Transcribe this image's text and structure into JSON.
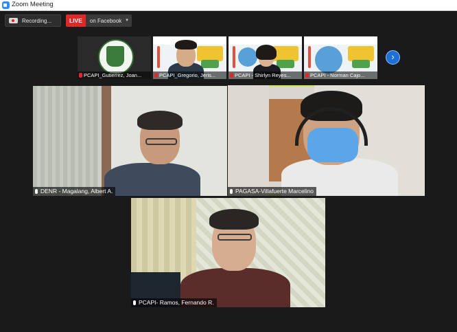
{
  "window": {
    "title": "Zoom Meeting"
  },
  "toolbar": {
    "recording_label": "Recording...",
    "live_badge": "LIVE",
    "stream_target": "on Facebook"
  },
  "strip": {
    "participants": [
      {
        "name": "PCAPI_Gutierrez, Joan..."
      },
      {
        "name": "PCAPI_Gregorio, Jeris..."
      },
      {
        "name": "PCAPI - Shirlyn Reyes..."
      },
      {
        "name": "PCAPI - Norman Cajo..."
      }
    ],
    "next_icon": "chevron-right-icon"
  },
  "gallery": {
    "participants": [
      {
        "name": "DENR - Magalang, Albert A."
      },
      {
        "name": "PAGASA-Villafuerte Marcelino"
      },
      {
        "name": "PCAPI- Ramos, Fernando R."
      }
    ],
    "active_speaker_color": "#c8e65a"
  }
}
